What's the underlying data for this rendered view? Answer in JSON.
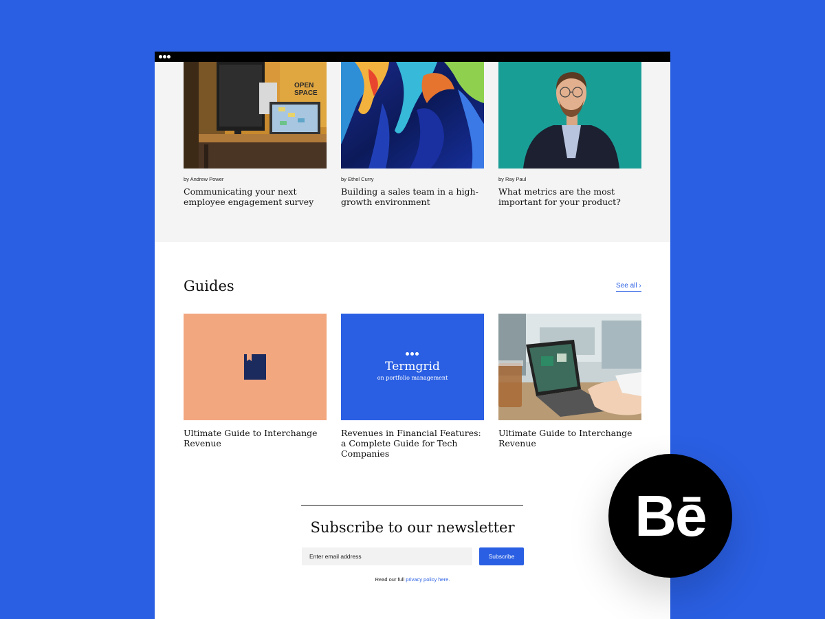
{
  "articles": [
    {
      "author": "by Andrew Power",
      "title": "Communicating your next employee engagement survey",
      "image": "office-desk-photo",
      "sign_text": "OPEN SPACE"
    },
    {
      "author": "by Ethel Curry",
      "title": "Building a sales team in a high-growth environment",
      "image": "abstract-gradient-art"
    },
    {
      "author": "by Ray Paul",
      "title": "What metrics are the most important for your product?",
      "image": "portrait-photo"
    }
  ],
  "guides": {
    "heading": "Guides",
    "see_all": "See all ›",
    "items": [
      {
        "title": "Ultimate Guide to Interchange Revenue",
        "image": "bookmark-cover",
        "color": "#f2a77f"
      },
      {
        "title": "Revenues in Financial Features: a Complete Guide for Tech Companies",
        "image": "termgrid-cover",
        "brand": "Termgrid",
        "subtitle": "on portfolio management",
        "color": "#2a5fe3"
      },
      {
        "title": "Ultimate Guide to Interchange Revenue",
        "image": "laptop-cafe-photo"
      }
    ]
  },
  "newsletter": {
    "title": "Subscribe to our newsletter",
    "placeholder": "Enter email address",
    "button": "Subscribe",
    "privacy_prefix": "Read our full ",
    "privacy_link": "privacy policy here."
  },
  "badge": {
    "text": "Bē",
    "icon": "behance-logo"
  },
  "colors": {
    "accent": "#2a5fe3",
    "background": "#2a5fe3",
    "top_section": "#f4f4f4"
  }
}
